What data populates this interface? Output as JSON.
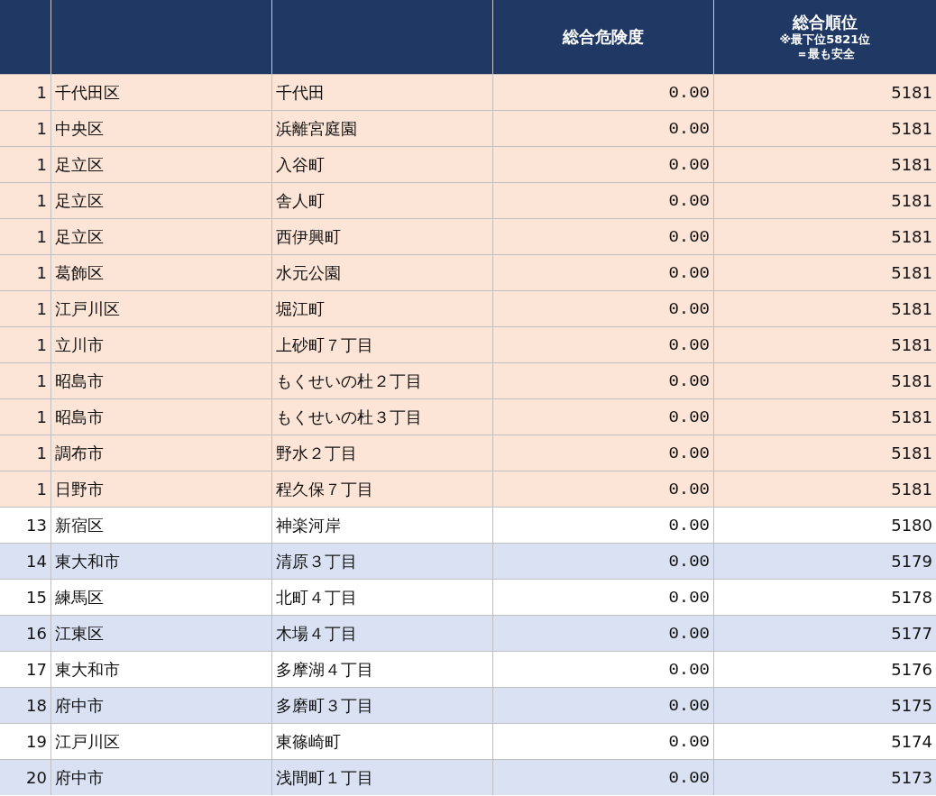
{
  "columns": [
    {
      "label": "総合危険度"
    },
    {
      "label": "総合順位",
      "notes": [
        "※最下位5821位",
        "＝最も安全"
      ]
    }
  ],
  "rows": [
    {
      "rank": "1",
      "city": "千代田区",
      "area": "千代田",
      "score": "0.00",
      "order": "5181",
      "highlighted": true
    },
    {
      "rank": "1",
      "city": "中央区",
      "area": "浜離宮庭園",
      "score": "0.00",
      "order": "5181",
      "highlighted": true
    },
    {
      "rank": "1",
      "city": "足立区",
      "area": "入谷町",
      "score": "0.00",
      "order": "5181",
      "highlighted": true
    },
    {
      "rank": "1",
      "city": "足立区",
      "area": "舎人町",
      "score": "0.00",
      "order": "5181",
      "highlighted": true
    },
    {
      "rank": "1",
      "city": "足立区",
      "area": "西伊興町",
      "score": "0.00",
      "order": "5181",
      "highlighted": true
    },
    {
      "rank": "1",
      "city": "葛飾区",
      "area": "水元公園",
      "score": "0.00",
      "order": "5181",
      "highlighted": true
    },
    {
      "rank": "1",
      "city": "江戸川区",
      "area": "堀江町",
      "score": "0.00",
      "order": "5181",
      "highlighted": true
    },
    {
      "rank": "1",
      "city": "立川市",
      "area": "上砂町７丁目",
      "score": "0.00",
      "order": "5181",
      "highlighted": true
    },
    {
      "rank": "1",
      "city": "昭島市",
      "area": "もくせいの杜２丁目",
      "score": "0.00",
      "order": "5181",
      "highlighted": true
    },
    {
      "rank": "1",
      "city": "昭島市",
      "area": "もくせいの杜３丁目",
      "score": "0.00",
      "order": "5181",
      "highlighted": true
    },
    {
      "rank": "1",
      "city": "調布市",
      "area": "野水２丁目",
      "score": "0.00",
      "order": "5181",
      "highlighted": true
    },
    {
      "rank": "1",
      "city": "日野市",
      "area": "程久保７丁目",
      "score": "0.00",
      "order": "5181",
      "highlighted": true
    },
    {
      "rank": "13",
      "city": "新宿区",
      "area": "神楽河岸",
      "score": "0.00",
      "order": "5180",
      "highlighted": false
    },
    {
      "rank": "14",
      "city": "東大和市",
      "area": "清原３丁目",
      "score": "0.00",
      "order": "5179",
      "highlighted": false
    },
    {
      "rank": "15",
      "city": "練馬区",
      "area": "北町４丁目",
      "score": "0.00",
      "order": "5178",
      "highlighted": false
    },
    {
      "rank": "16",
      "city": "江東区",
      "area": "木場４丁目",
      "score": "0.00",
      "order": "5177",
      "highlighted": false
    },
    {
      "rank": "17",
      "city": "東大和市",
      "area": "多摩湖４丁目",
      "score": "0.00",
      "order": "5176",
      "highlighted": false
    },
    {
      "rank": "18",
      "city": "府中市",
      "area": "多磨町３丁目",
      "score": "0.00",
      "order": "5175",
      "highlighted": false
    },
    {
      "rank": "19",
      "city": "江戸川区",
      "area": "東篠崎町",
      "score": "0.00",
      "order": "5174",
      "highlighted": false
    },
    {
      "rank": "20",
      "city": "府中市",
      "area": "浅間町１丁目",
      "score": "0.00",
      "order": "5173",
      "highlighted": false
    }
  ]
}
